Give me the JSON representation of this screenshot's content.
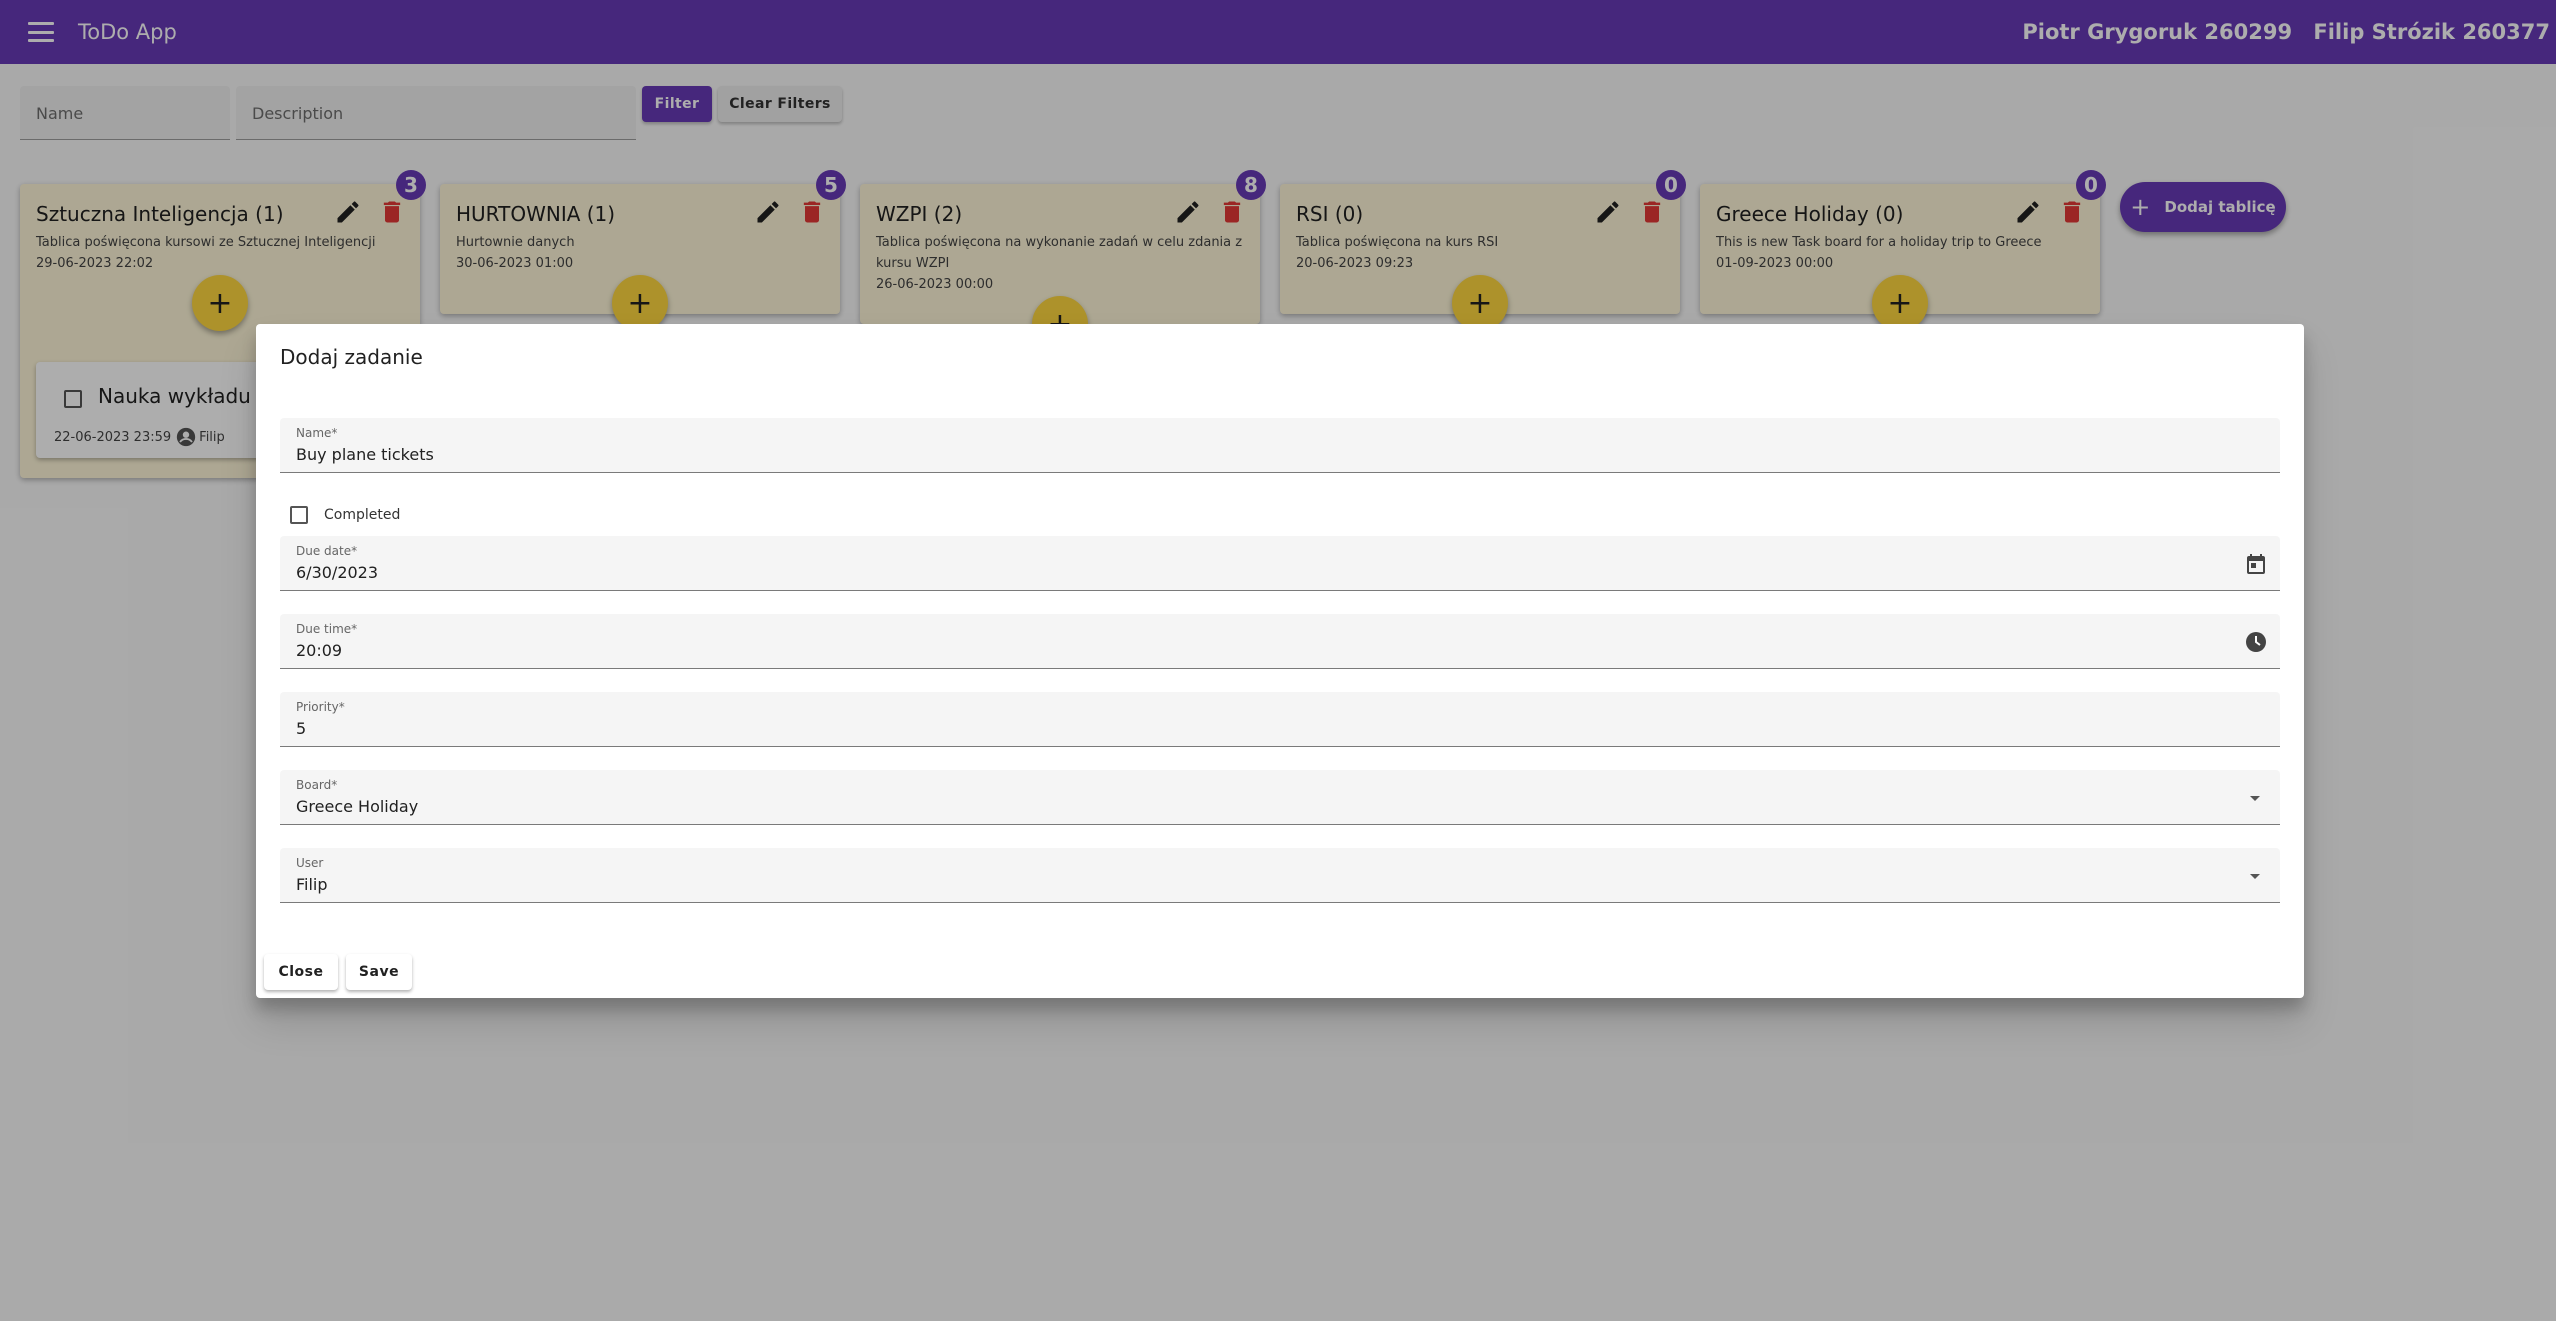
{
  "app": {
    "title": "ToDo App",
    "authors": [
      "Piotr Grygoruk 260299",
      "Filip Strózik 260377"
    ]
  },
  "filters": {
    "name_placeholder": "Name",
    "description_placeholder": "Description",
    "filter_label": "Filter",
    "clear_label": "Clear Filters"
  },
  "boards": [
    {
      "title": "Sztuczna Inteligencja (1)",
      "description": "Tablica poświęcona kursowi ze Sztucznej Inteligencji",
      "date": "29-06-2023 22:02",
      "badge": "3"
    },
    {
      "title": "HURTOWNIA (1)",
      "description": "Hurtownie danych",
      "date": "30-06-2023 01:00",
      "badge": "5"
    },
    {
      "title": "WZPI (2)",
      "description": "Tablica poświęcona na wykonanie zadań w celu zdania z kursu WZPI",
      "date": "26-06-2023 00:00",
      "badge": "8"
    },
    {
      "title": "RSI (0)",
      "description": "Tablica poświęcona na kurs RSI",
      "date": "20-06-2023 09:23",
      "badge": "0"
    },
    {
      "title": "Greece Holiday (0)",
      "description": "This is new Task board for a holiday trip to Greece",
      "date": "01-09-2023 00:00",
      "badge": "0"
    }
  ],
  "task_preview": {
    "title": "Nauka wykładu 1",
    "date": "22-06-2023 23:59",
    "user": "Filip"
  },
  "add_board_label": "Dodaj tablicę",
  "dialog": {
    "title": "Dodaj zadanie",
    "name": {
      "label": "Name*",
      "value": "Buy plane tickets"
    },
    "completed_label": "Completed",
    "completed": false,
    "due_date": {
      "label": "Due date*",
      "value": "6/30/2023"
    },
    "due_time": {
      "label": "Due time*",
      "value": "20:09"
    },
    "priority": {
      "label": "Priority*",
      "value": "5"
    },
    "board": {
      "label": "Board*",
      "value": "Greece Holiday"
    },
    "user": {
      "label": "User",
      "value": "Filip"
    },
    "close_label": "Close",
    "save_label": "Save"
  },
  "colors": {
    "primary": "#673ab7",
    "accent": "#ffd740",
    "danger": "#e53935"
  },
  "icons": {
    "menu": "menu-icon",
    "edit": "pencil-icon",
    "delete": "trash-icon",
    "add": "plus-icon",
    "calendar": "calendar-icon",
    "clock": "clock-icon",
    "user": "account-circle-icon",
    "dropdown": "dropdown-arrow-icon"
  }
}
